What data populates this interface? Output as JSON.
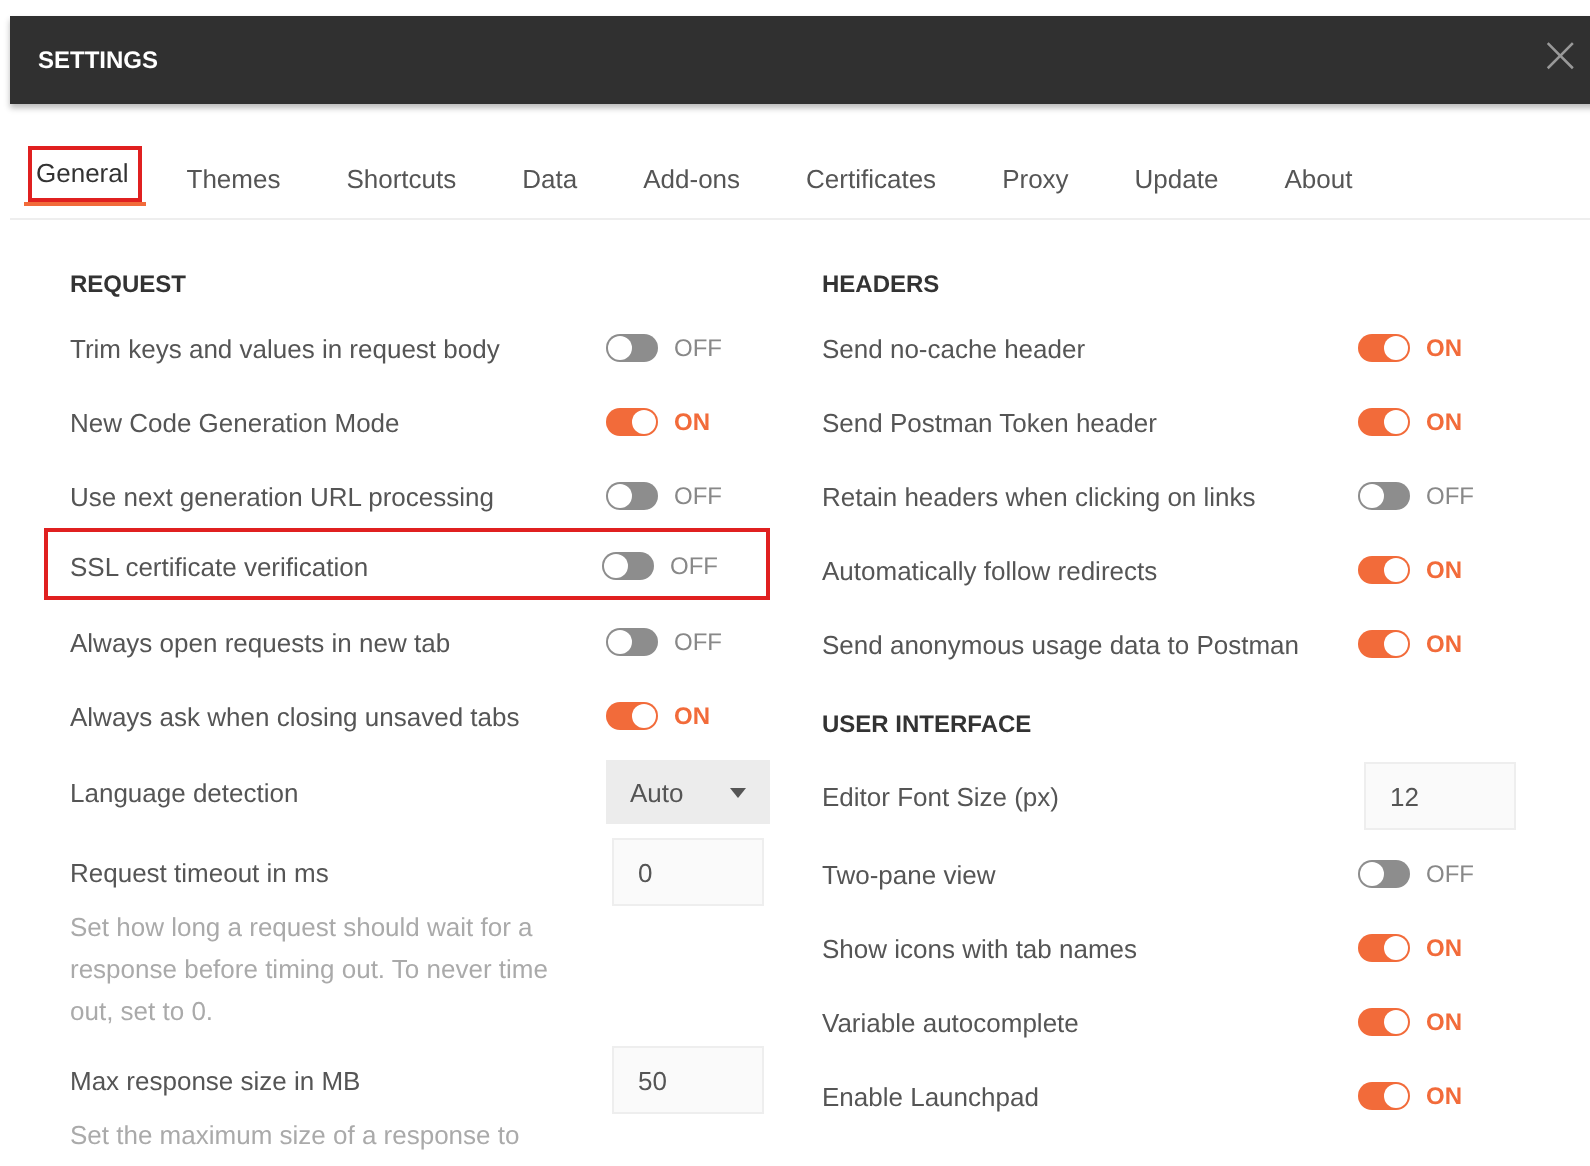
{
  "window": {
    "title": "SETTINGS",
    "close": "×"
  },
  "tabs": [
    {
      "label": "General",
      "selected": true,
      "highlighted": true
    },
    {
      "label": "Themes",
      "selected": false,
      "highlighted": false
    },
    {
      "label": "Shortcuts",
      "selected": false,
      "highlighted": false
    },
    {
      "label": "Data",
      "selected": false,
      "highlighted": false
    },
    {
      "label": "Add-ons",
      "selected": false,
      "highlighted": false
    },
    {
      "label": "Certificates",
      "selected": false,
      "highlighted": false
    },
    {
      "label": "Proxy",
      "selected": false,
      "highlighted": false
    },
    {
      "label": "Update",
      "selected": false,
      "highlighted": false
    },
    {
      "label": "About",
      "selected": false,
      "highlighted": false
    }
  ],
  "columns": [
    {
      "sections": [
        {
          "heading": "REQUEST",
          "settings": [
            {
              "kind": "toggle",
              "label": "Trim keys and values in request body",
              "on": false,
              "state_text": "OFF",
              "highlighted": false
            },
            {
              "kind": "toggle",
              "label": "New Code Generation Mode",
              "on": true,
              "state_text": "ON",
              "highlighted": false
            },
            {
              "kind": "toggle",
              "label": "Use next generation URL processing",
              "on": false,
              "state_text": "OFF",
              "highlighted": false
            },
            {
              "kind": "toggle",
              "label": "SSL certificate verification",
              "on": false,
              "state_text": "OFF",
              "highlighted": true
            },
            {
              "kind": "toggle",
              "label": "Always open requests in new tab",
              "on": false,
              "state_text": "OFF",
              "highlighted": false
            },
            {
              "kind": "toggle",
              "label": "Always ask when closing unsaved tabs",
              "on": true,
              "state_text": "ON",
              "highlighted": false
            },
            {
              "kind": "select",
              "label": "Language detection",
              "value": "Auto"
            },
            {
              "kind": "number",
              "label": "Request timeout in ms",
              "value": "0",
              "description": "Set how long a request should wait for a response before timing out. To never time out, set to 0."
            },
            {
              "kind": "number",
              "label": "Max response size in MB",
              "value": "50",
              "description": "Set the maximum size of a response to"
            }
          ]
        }
      ]
    },
    {
      "sections": [
        {
          "heading": "HEADERS",
          "settings": [
            {
              "kind": "toggle",
              "label": "Send no-cache header",
              "on": true,
              "state_text": "ON",
              "highlighted": false
            },
            {
              "kind": "toggle",
              "label": "Send Postman Token header",
              "on": true,
              "state_text": "ON",
              "highlighted": false
            },
            {
              "kind": "toggle",
              "label": "Retain headers when clicking on links",
              "on": false,
              "state_text": "OFF",
              "highlighted": false
            },
            {
              "kind": "toggle",
              "label": "Automatically follow redirects",
              "on": true,
              "state_text": "ON",
              "highlighted": false
            },
            {
              "kind": "toggle",
              "label": "Send anonymous usage data to Postman",
              "on": true,
              "state_text": "ON",
              "highlighted": false
            }
          ]
        },
        {
          "heading": "USER INTERFACE",
          "settings": [
            {
              "kind": "number",
              "label": "Editor Font Size (px)",
              "value": "12"
            },
            {
              "kind": "toggle",
              "label": "Two-pane view",
              "on": false,
              "state_text": "OFF",
              "highlighted": false
            },
            {
              "kind": "toggle",
              "label": "Show icons with tab names",
              "on": true,
              "state_text": "ON",
              "highlighted": false
            },
            {
              "kind": "toggle",
              "label": "Variable autocomplete",
              "on": true,
              "state_text": "ON",
              "highlighted": false
            },
            {
              "kind": "toggle",
              "label": "Enable Launchpad",
              "on": true,
              "state_text": "ON",
              "highlighted": false
            }
          ]
        }
      ]
    }
  ]
}
